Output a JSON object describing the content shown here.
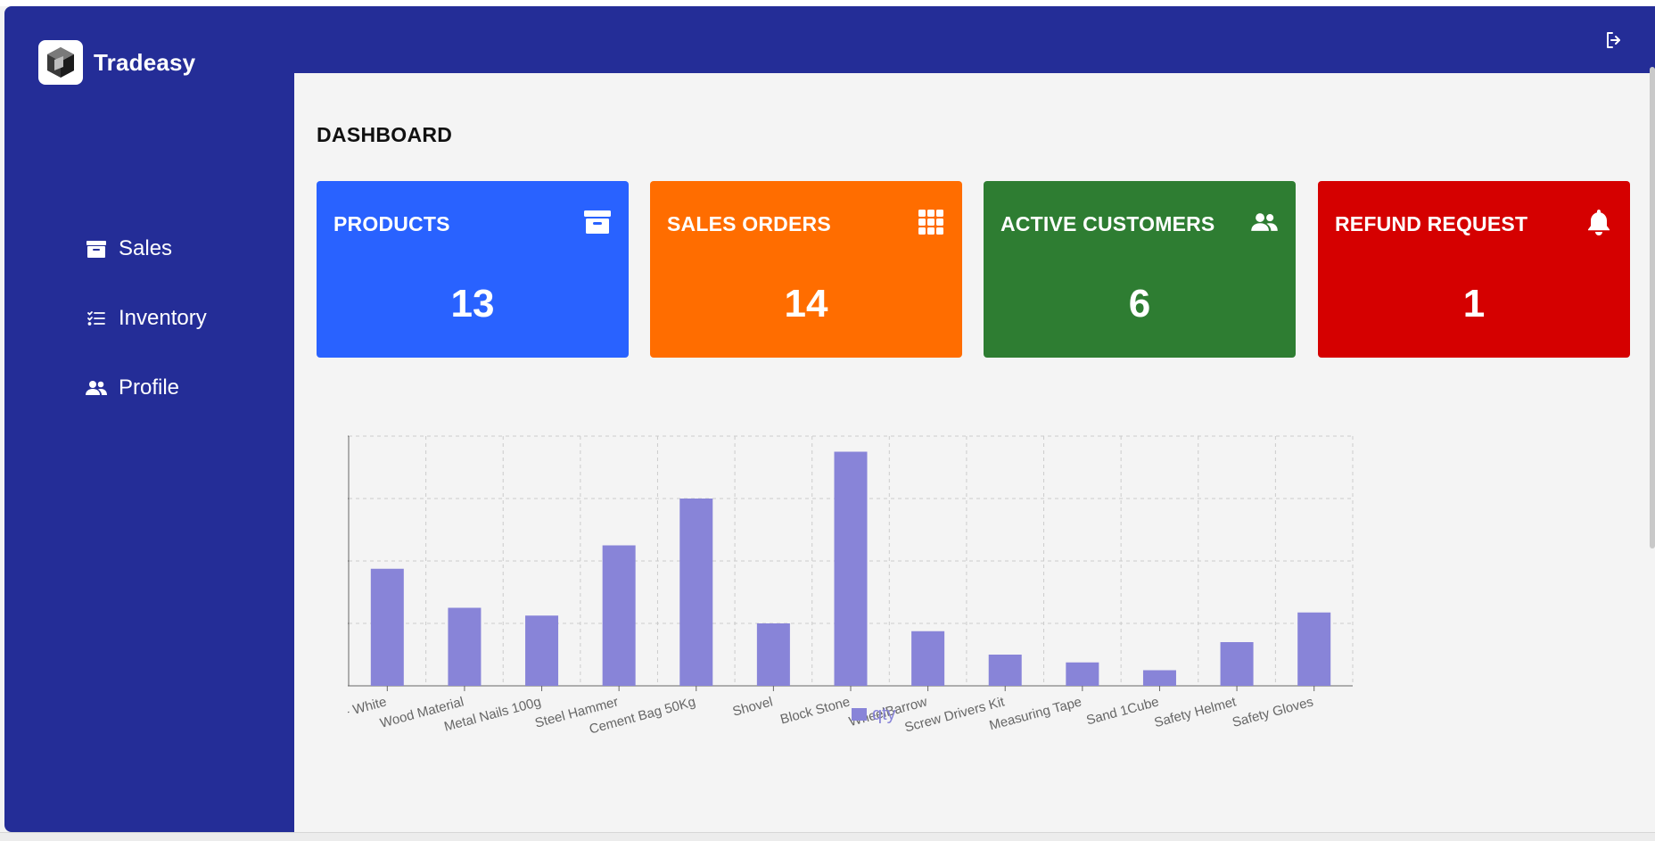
{
  "app": {
    "name": "Tradeasy"
  },
  "sidebar": {
    "items": [
      {
        "label": "Sales",
        "icon": "archive-icon"
      },
      {
        "label": "Inventory",
        "icon": "list-icon"
      },
      {
        "label": "Profile",
        "icon": "users-icon"
      }
    ]
  },
  "header": {
    "logout_icon": "logout-icon"
  },
  "page": {
    "title": "DASHBOARD"
  },
  "cards": [
    {
      "label": "PRODUCTS",
      "value": "13",
      "color": "#2962ff",
      "icon": "archive-icon"
    },
    {
      "label": "SALES ORDERS",
      "value": "14",
      "color": "#ff6d00",
      "icon": "grid-icon"
    },
    {
      "label": "ACTIVE CUSTOMERS",
      "value": "6",
      "color": "#2e7d32",
      "icon": "users-icon"
    },
    {
      "label": "REFUND REQUEST",
      "value": "1",
      "color": "#d50000",
      "icon": "bell-icon"
    }
  ],
  "colors": {
    "sidebar": "#242d97",
    "bar": "#8884d8"
  },
  "chart_data": {
    "type": "bar",
    "categories": [
      "Paint - White",
      "Wood Material",
      "Metal Nails 100g",
      "Steel Hammer",
      "Cement Bag 50Kg",
      "Shovel",
      "Block Stone",
      "WheelBarrow",
      "Screw Drivers Kit",
      "Measuring Tape",
      "Sand 1Cube",
      "Safety Helmet",
      "Safety Gloves"
    ],
    "series": [
      {
        "name": "qty",
        "values": [
          75,
          50,
          45,
          90,
          120,
          40,
          150,
          35,
          20,
          15,
          10,
          28,
          47
        ]
      }
    ],
    "ylim": [
      0,
      160
    ],
    "yticks": [
      0,
      40,
      80,
      120,
      160
    ],
    "grid": true,
    "legend": "bottom"
  }
}
